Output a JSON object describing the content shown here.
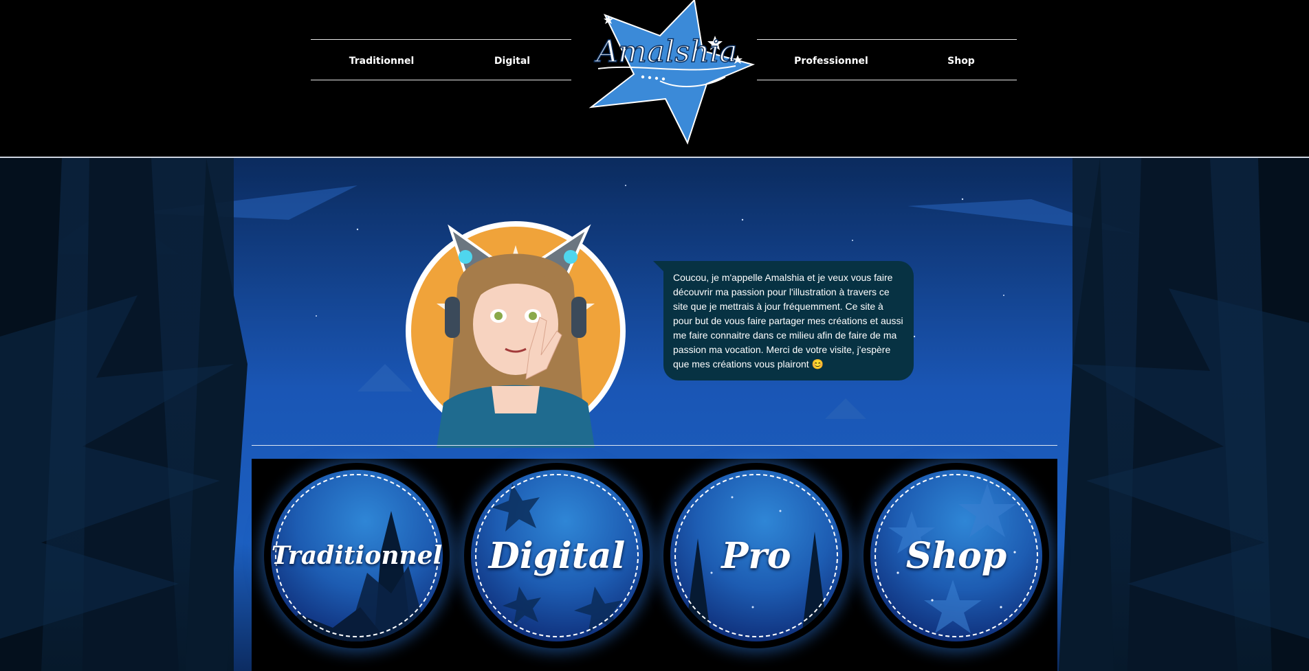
{
  "header": {
    "logo_text": "Amalshia",
    "nav_left": [
      {
        "label": "Traditionnel"
      },
      {
        "label": "Digital"
      }
    ],
    "nav_right": [
      {
        "label": "Professionnel"
      },
      {
        "label": "Shop"
      }
    ]
  },
  "intro": {
    "text": "Coucou, je m'appelle Amalshia et je veux vous faire découvrir ma passion pour l'illustration à travers ce site que je mettrais à jour fréquemment. Ce site à pour but de vous faire partager mes créations et aussi me faire connaitre dans ce milieu afin de faire de ma passion ma vocation. Merci de votre visite, j'espère que mes créations vous plairont 😊"
  },
  "categories": [
    {
      "label": "Traditionnel"
    },
    {
      "label": "Digital"
    },
    {
      "label": "Pro"
    },
    {
      "label": "Shop"
    }
  ],
  "colors": {
    "accent": "#3b8ad8",
    "speech_bg": "#073243",
    "avatar_bg": "#f0a33a"
  },
  "icons": {
    "logo": "star-logo",
    "avatar": "cat-ear-headphones-avatar"
  }
}
